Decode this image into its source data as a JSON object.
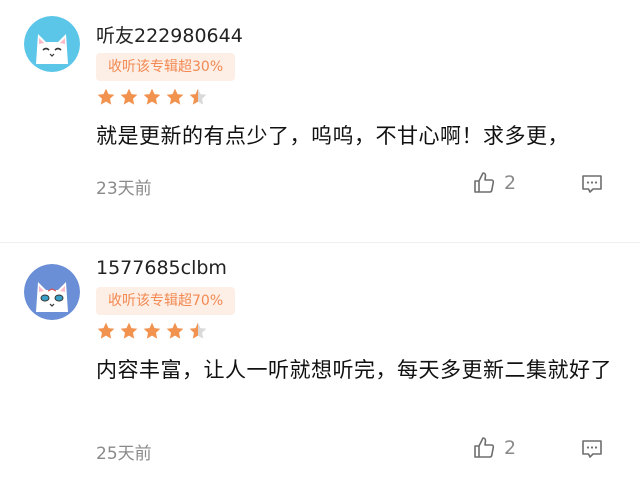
{
  "colors": {
    "star": "#f2924f",
    "badge_bg": "#fdeee6",
    "badge_text": "#f28a52",
    "meta_text": "#8a8a8a"
  },
  "comments": [
    {
      "avatar": "white-cat-avatar",
      "username": "听友222980644",
      "badge": "收听该专辑超30%",
      "rating": 4.5,
      "content": "就是更新的有点少了，呜呜，不甘心啊！求多更，",
      "time": "23天前",
      "likes": "2",
      "like_icon": "thumbs-up-icon",
      "reply_icon": "comment-icon"
    },
    {
      "avatar": "blue-cat-avatar",
      "username": "1577685clbm",
      "badge": "收听该专辑超70%",
      "rating": 4.5,
      "content": "内容丰富，让人一听就想听完，每天多更新二集就好了",
      "time": "25天前",
      "likes": "2",
      "like_icon": "thumbs-up-icon",
      "reply_icon": "comment-icon"
    }
  ]
}
